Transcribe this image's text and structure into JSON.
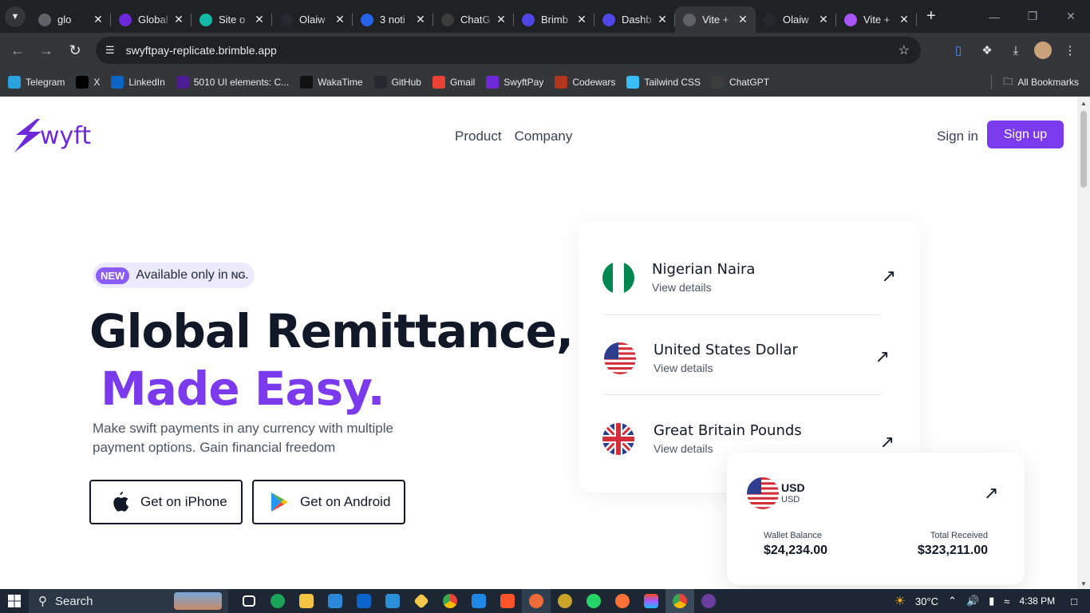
{
  "browser": {
    "tabs": [
      {
        "title": "glo",
        "icon": "globe-icon",
        "color": "#5f6368",
        "active": false
      },
      {
        "title": "Global",
        "icon": "swyft-icon",
        "color": "#6d28d9",
        "active": false
      },
      {
        "title": "Site o",
        "icon": "netlify-icon",
        "color": "#14b8a6",
        "active": false
      },
      {
        "title": "Olaiw",
        "icon": "github-icon",
        "color": "#24292f",
        "active": false
      },
      {
        "title": "3 noti",
        "icon": "notification-icon",
        "color": "#2563eb",
        "active": false
      },
      {
        "title": "ChatG",
        "icon": "chatgpt-icon",
        "color": "#3c3c3c",
        "active": false
      },
      {
        "title": "Brimb",
        "icon": "brimble-icon",
        "color": "#4f46e5",
        "active": false
      },
      {
        "title": "Dashb",
        "icon": "brimble-icon",
        "color": "#4f46e5",
        "active": false
      },
      {
        "title": "Vite +",
        "icon": "globe-icon",
        "color": "#5f6368",
        "active": true
      },
      {
        "title": "Olaiw",
        "icon": "github-icon",
        "color": "#24292f",
        "active": false
      },
      {
        "title": "Vite +",
        "icon": "vite-icon",
        "color": "#a855f7",
        "active": false
      }
    ],
    "url": "swyftpay-replicate.brimble.app",
    "bookmarks": [
      {
        "label": "Telegram",
        "icon": "telegram-icon",
        "color": "#2aa3df"
      },
      {
        "label": "X",
        "icon": "x-icon",
        "color": "#000000"
      },
      {
        "label": "LinkedIn",
        "icon": "linkedin-icon",
        "color": "#0a66c2"
      },
      {
        "label": "5010 UI elements: C...",
        "icon": "uiverse-icon",
        "color": "#4c1d95"
      },
      {
        "label": "WakaTime",
        "icon": "wakatime-icon",
        "color": "#111111"
      },
      {
        "label": "GitHub",
        "icon": "github-icon",
        "color": "#24292f"
      },
      {
        "label": "Gmail",
        "icon": "gmail-icon",
        "color": "#ea4335"
      },
      {
        "label": "SwyftPay",
        "icon": "swyft-icon",
        "color": "#6d28d9"
      },
      {
        "label": "Codewars",
        "icon": "codewars-icon",
        "color": "#b1361e"
      },
      {
        "label": "Tailwind CSS",
        "icon": "tailwind-icon",
        "color": "#38bdf8"
      },
      {
        "label": "ChatGPT",
        "icon": "chatgpt-icon",
        "color": "#3c3c3c"
      }
    ],
    "all_bookmarks": "All Bookmarks"
  },
  "site": {
    "brand": "wyft",
    "nav": [
      "Product",
      "Company"
    ],
    "signin": "Sign in",
    "signup": "Sign up",
    "badge_new": "NEW",
    "badge_text": "Available only in",
    "badge_country": "NG.",
    "headline_line1": "Global Remittance,",
    "headline_line2": "Made Easy.",
    "subtext": "Make swift payments in any currency with multiple payment options. Gain financial freedom",
    "ios_button": "Get on iPhone",
    "android_button": "Get on Android",
    "accent_color": "#7c3aed",
    "currencies": [
      {
        "name": "Nigerian Naira",
        "details": "View details",
        "flag": "nigeria-flag-icon"
      },
      {
        "name": "United States Dollar",
        "details": "View details",
        "flag": "usa-flag-icon"
      },
      {
        "name": "Great Britain Pounds",
        "details": "View details",
        "flag": "uk-flag-icon"
      }
    ],
    "wallet": {
      "code": "USD",
      "code_sub": "USD",
      "balance_label": "Wallet Balance",
      "balance_value": "$24,234.00",
      "received_label": "Total Received",
      "received_value": "$323,211.00"
    }
  },
  "taskbar": {
    "search": "Search",
    "temperature": "30°C",
    "time": "4:38 PM"
  }
}
